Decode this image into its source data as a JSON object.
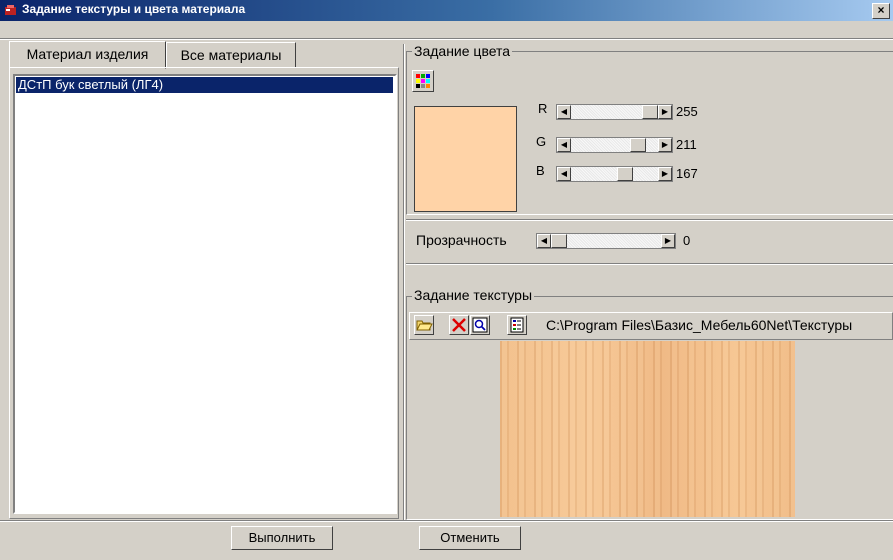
{
  "window": {
    "title": "Задание текстуры и цвета материала",
    "close_glyph": "×"
  },
  "tabs": [
    {
      "label": "Материал изделия"
    },
    {
      "label": "Все материалы"
    }
  ],
  "materials": [
    {
      "label": "ДСтП бук светлый (ЛГ4)",
      "selected": true
    }
  ],
  "color_group": {
    "label": "Задание цвета",
    "swatch_color": "#ffd3a7",
    "channels": [
      {
        "name": "R",
        "value": "255",
        "level": 1.0
      },
      {
        "name": "G",
        "value": "211",
        "level": 0.83
      },
      {
        "name": "B",
        "value": "167",
        "level": 0.65
      }
    ]
  },
  "transparency": {
    "label": "Прозрачность",
    "value": "0",
    "level": 0.0
  },
  "texture_group": {
    "label": "Задание текстуры",
    "path": "C:\\Program Files\\Базис_Мебель60Net\\Текстуры",
    "tools": [
      "folder-open-icon",
      "delete-icon",
      "zoom-icon",
      "properties-icon"
    ]
  },
  "buttons": {
    "ok": "Выполнить",
    "cancel": "Отменить"
  },
  "colors": {
    "titlebar": "#0a246a",
    "selection": "#0a246a",
    "face": "#d4d0c8"
  }
}
